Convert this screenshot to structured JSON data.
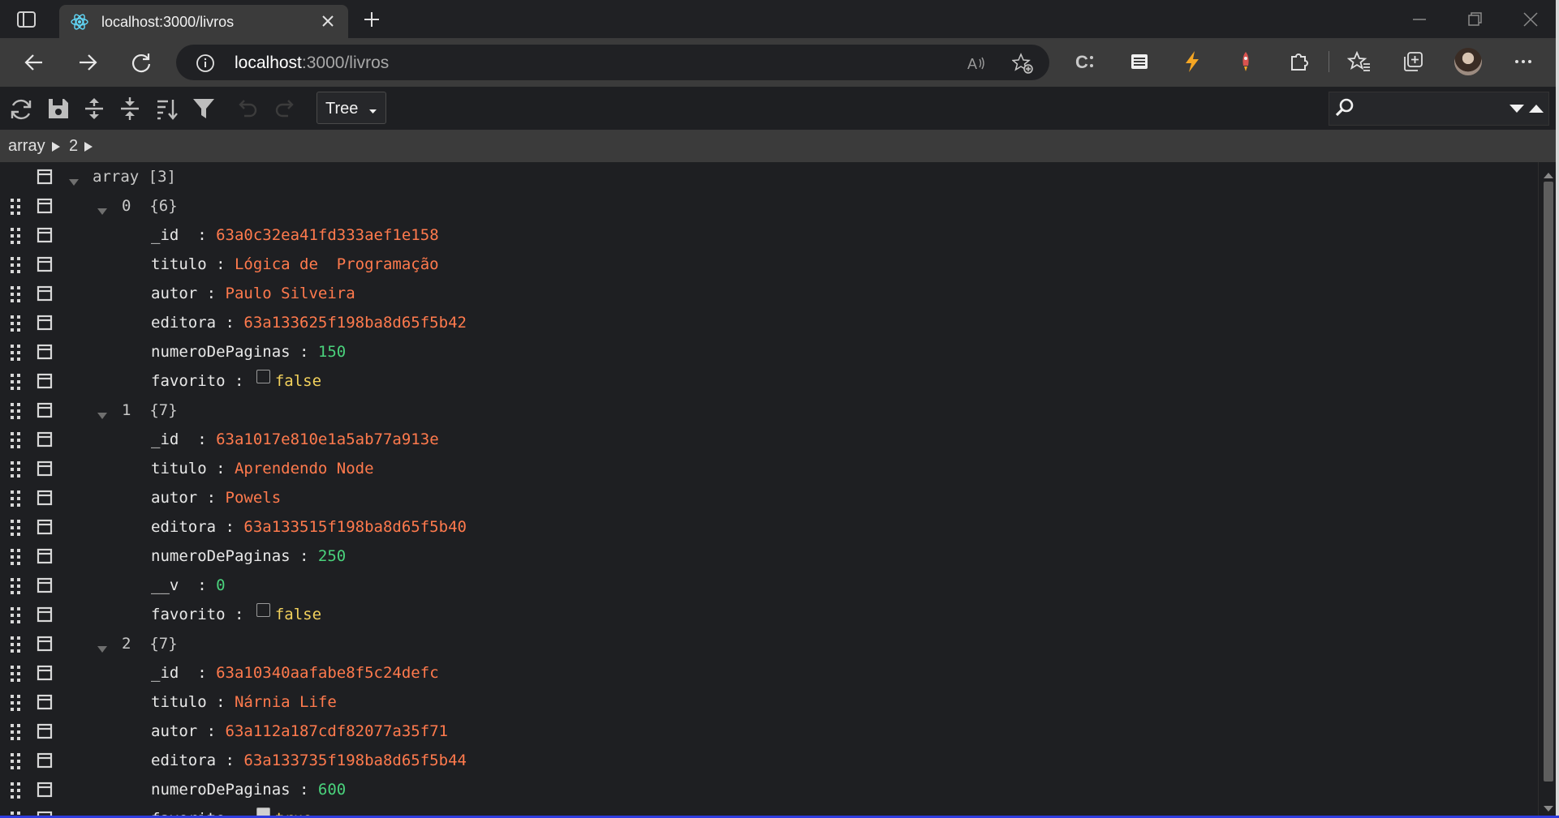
{
  "browser": {
    "tab_title": "localhost:3000/livros",
    "url_host": "localhost",
    "url_path": ":3000/livros",
    "icons": [
      "sidebar-icon",
      "react-favicon",
      "close-icon",
      "plus-icon",
      "minimize-icon",
      "restore-icon",
      "close-window-icon",
      "back-icon",
      "forward-icon",
      "refresh-icon",
      "info-icon",
      "read-aloud-icon",
      "add-favorite-icon",
      "extension-c-icon",
      "extension-table-icon",
      "extension-bolt-icon",
      "extension-rocket-icon",
      "extensions-puzzle-icon",
      "favorites-icon",
      "collections-icon",
      "profile-avatar",
      "more-icon"
    ]
  },
  "viewer": {
    "mode_label": "Tree",
    "toolbar_icons": [
      "refresh-icon",
      "save-icon",
      "expand-all-icon",
      "collapse-all-icon",
      "sort-icon",
      "filter-icon",
      "undo-icon",
      "redo-icon"
    ],
    "breadcrumb": [
      "array",
      "2"
    ],
    "search_placeholder": ""
  },
  "tree": [
    {
      "type": "root",
      "indent": 0,
      "label": "array",
      "meta": "[3]",
      "expander": true
    },
    {
      "type": "object",
      "indent": 1,
      "label": "0",
      "meta": "{6}",
      "expander": true
    },
    {
      "type": "field",
      "indent": 2,
      "key": "_id",
      "value": "63a0c32ea41fd333aef1e158",
      "vtype": "str"
    },
    {
      "type": "field",
      "indent": 2,
      "key": "titulo",
      "value": "Lógica de  Programação",
      "vtype": "str"
    },
    {
      "type": "field",
      "indent": 2,
      "key": "autor",
      "value": "Paulo Silveira",
      "vtype": "str"
    },
    {
      "type": "field",
      "indent": 2,
      "key": "editora",
      "value": "63a133625f198ba8d65f5b42",
      "vtype": "str"
    },
    {
      "type": "field",
      "indent": 2,
      "key": "numeroDePaginas",
      "value": "150",
      "vtype": "num"
    },
    {
      "type": "field",
      "indent": 2,
      "key": "favorito",
      "value": "false",
      "vtype": "bool",
      "checked": false
    },
    {
      "type": "object",
      "indent": 1,
      "label": "1",
      "meta": "{7}",
      "expander": true
    },
    {
      "type": "field",
      "indent": 2,
      "key": "_id",
      "value": "63a1017e810e1a5ab77a913e",
      "vtype": "str"
    },
    {
      "type": "field",
      "indent": 2,
      "key": "titulo",
      "value": "Aprendendo Node",
      "vtype": "str"
    },
    {
      "type": "field",
      "indent": 2,
      "key": "autor",
      "value": "Powels",
      "vtype": "str"
    },
    {
      "type": "field",
      "indent": 2,
      "key": "editora",
      "value": "63a133515f198ba8d65f5b40",
      "vtype": "str"
    },
    {
      "type": "field",
      "indent": 2,
      "key": "numeroDePaginas",
      "value": "250",
      "vtype": "num"
    },
    {
      "type": "field",
      "indent": 2,
      "key": "__v",
      "value": "0",
      "vtype": "num"
    },
    {
      "type": "field",
      "indent": 2,
      "key": "favorito",
      "value": "false",
      "vtype": "bool",
      "checked": false
    },
    {
      "type": "object",
      "indent": 1,
      "label": "2",
      "meta": "{7}",
      "expander": true
    },
    {
      "type": "field",
      "indent": 2,
      "key": "_id",
      "value": "63a10340aafabe8f5c24defc",
      "vtype": "str"
    },
    {
      "type": "field",
      "indent": 2,
      "key": "titulo",
      "value": "Nárnia Life",
      "vtype": "str"
    },
    {
      "type": "field",
      "indent": 2,
      "key": "autor",
      "value": "63a112a187cdf82077a35f71",
      "vtype": "str"
    },
    {
      "type": "field",
      "indent": 2,
      "key": "editora",
      "value": "63a133735f198ba8d65f5b44",
      "vtype": "str"
    },
    {
      "type": "field",
      "indent": 2,
      "key": "numeroDePaginas",
      "value": "600",
      "vtype": "num"
    },
    {
      "type": "field",
      "indent": 2,
      "key": "favorito",
      "value": "true",
      "vtype": "bool",
      "checked": true
    }
  ]
}
